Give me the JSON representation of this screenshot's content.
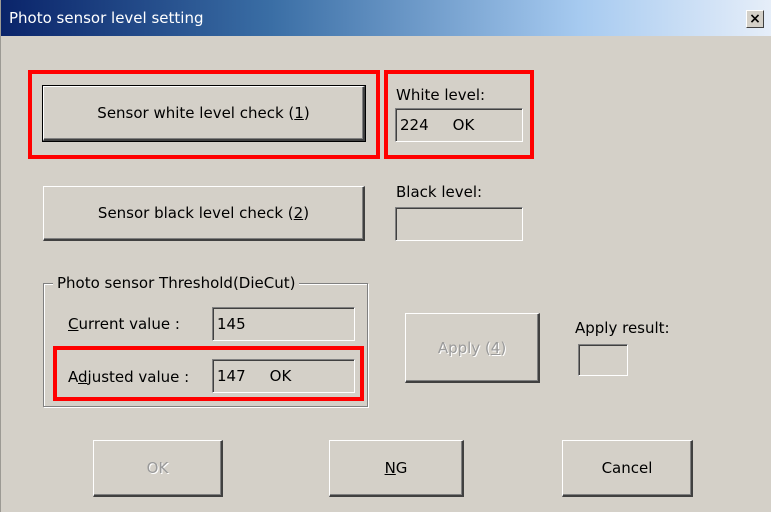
{
  "window": {
    "title": "Photo sensor level setting",
    "close_label": "×"
  },
  "white_check": {
    "label_pre": "Sensor white level check (",
    "mnemonic": "1",
    "label_post": ")"
  },
  "black_check": {
    "label_pre": "Sensor black level check (",
    "mnemonic": "2",
    "label_post": ")"
  },
  "white_level": {
    "label": "White level:",
    "value": "224",
    "status": "OK"
  },
  "black_level": {
    "label": "Black level:",
    "value": ""
  },
  "threshold": {
    "group_title": "Photo sensor Threshold(DieCut)",
    "current": {
      "label_mn": "C",
      "label_rest": "urrent value :",
      "value": "145"
    },
    "adjusted": {
      "label_pre": "A",
      "label_mn": "d",
      "label_rest": "justed value :",
      "value": "147",
      "status": "OK"
    }
  },
  "apply": {
    "label_pre": "Apply (",
    "mnemonic": "4",
    "label_post": ")",
    "result_label": "Apply result:",
    "result_value": ""
  },
  "footer": {
    "ok_label": "OK",
    "ng_mn": "N",
    "ng_rest": "G",
    "cancel_label": "Cancel"
  },
  "colors": {
    "highlight": "#ff0000",
    "dialog_bg": "#d4d0c8",
    "title_bar": "#0a246a"
  }
}
